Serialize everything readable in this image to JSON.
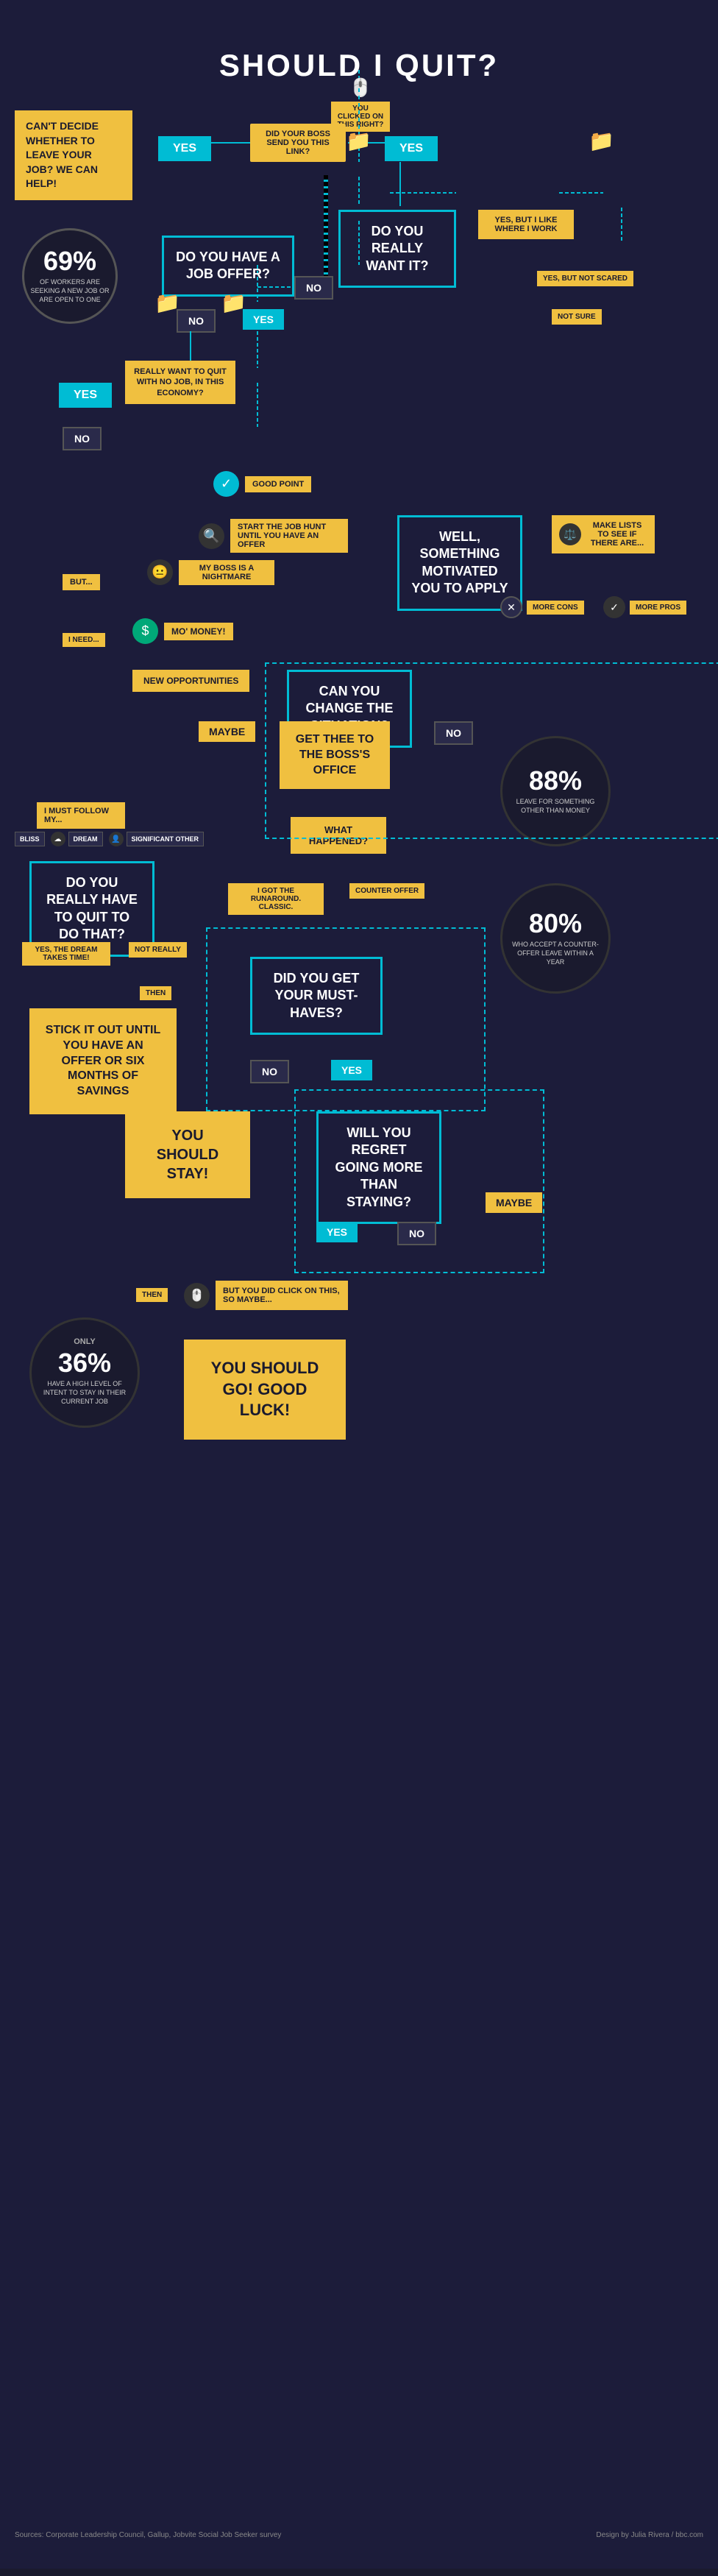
{
  "title": "SHOULD I QUIT?",
  "subtitle": "CAN'T DECIDE WHETHER TO LEAVE YOUR JOB? WE CAN HELP!",
  "stat1": {
    "number": "69%",
    "description": "OF WORKERS ARE SEEKING A NEW JOB OR ARE OPEN TO ONE"
  },
  "stat2": {
    "number": "88%",
    "description": "LEAVE FOR SOMETHING OTHER THAN MONEY"
  },
  "stat3": {
    "number": "80%",
    "description": "WHO ACCEPT A COUNTER-OFFER LEAVE WITHIN A YEAR"
  },
  "stat4": {
    "number": "36%",
    "description": "HAVE A HIGH LEVEL OF INTENT TO STAY IN THEIR CURRENT JOB",
    "prefix": "ONLY"
  },
  "nodes": {
    "click": "YOU CLICKED ON THIS RIGHT?",
    "yes1": "YES",
    "did_boss": "DID YOUR BOSS SEND YOU THIS LINK?",
    "yes2": "YES",
    "no1": "NO",
    "job_offer": "DO YOU HAVE A JOB OFFER?",
    "no2": "NO",
    "yes3": "YES",
    "do_you_want": "DO YOU REALLY WANT IT?",
    "yes_but": "YES, BUT I LIKE WHERE I WORK",
    "yes_not_scared": "YES, BUT NOT SCARED",
    "not_sure": "NOT SURE",
    "really_want": "REALLY WANT TO QUIT WITH NO JOB, IN THIS ECONOMY?",
    "yes4": "YES",
    "no3": "NO",
    "good_point": "GOOD POINT",
    "start_job_hunt": "START THE JOB HUNT UNTIL YOU HAVE AN OFFER",
    "but": "BUT...",
    "boss_nightmare": "MY BOSS IS A NIGHTMARE",
    "something_motivated": "WELL, SOMETHING MOTIVATED YOU TO APPLY",
    "make_lists": "MAKE LISTS TO SEE IF THERE ARE...",
    "more_cons": "MORE CONS",
    "more_pros": "MORE PROS",
    "i_need": "I NEED...",
    "mo_money": "MO' MONEY!",
    "new_opportunities": "NEW OPPORTUNITIES",
    "can_you_change": "CAN YOU CHANGE THE SITUATION?",
    "maybe": "MAYBE",
    "no4": "NO",
    "get_thee": "GET THEE TO THE BOSS'S OFFICE",
    "i_must_follow": "I MUST FOLLOW MY...",
    "bliss": "BLISS",
    "dream": "DREAM",
    "significant_other": "SIGNIFICANT OTHER",
    "do_really_have": "DO YOU REALLY HAVE TO QUIT TO DO THAT?",
    "yes_dream": "YES, THE DREAM TAKES TIME!",
    "not_really": "NOT REALLY",
    "then": "THEN",
    "stick_it_out": "STICK IT OUT UNTIL YOU HAVE AN OFFER OR SIX MONTHS OF SAVINGS",
    "what_happened": "WHAT HAPPENED?",
    "i_got_runaround": "I GOT THE RUNAROUND. CLASSIC.",
    "counter_offer": "COUNTER OFFER",
    "did_you_get": "DID YOU GET YOUR MUST-HAVES?",
    "no5": "NO",
    "yes5": "YES",
    "you_should_stay": "YOU SHOULD STAY!",
    "will_you_regret": "WILL YOU REGRET GOING MORE THAN STAYING?",
    "maybe2": "MAYBE",
    "yes6": "YES",
    "no6": "NO",
    "but_you_did": "BUT YOU DID CLICK ON THIS, SO MAYBE...",
    "then2": "THEN",
    "you_should_go": "YOU SHOULD GO! GOOD LUCK!",
    "source": "Sources: Corporate Leadership Council, Gallup, Jobvite Social Job Seeker survey",
    "design": "Design by Julia Rivera / bbc.com"
  }
}
